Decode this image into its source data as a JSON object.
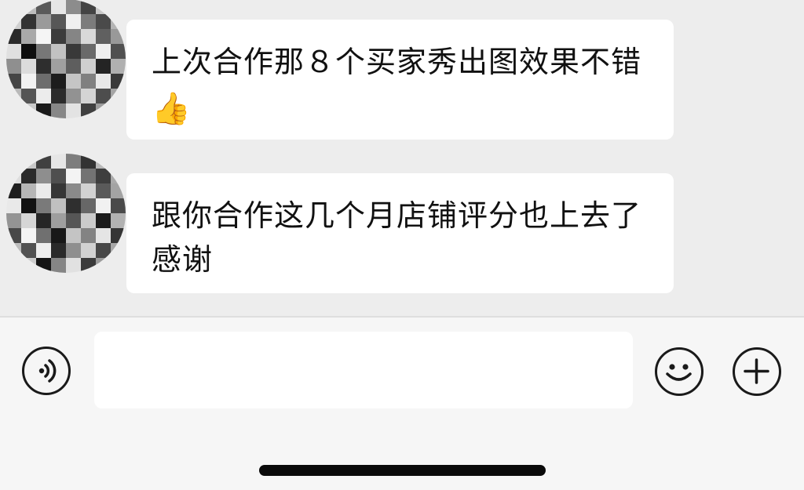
{
  "messages": [
    {
      "text": "上次合作那８个买家秀出图效果不错",
      "emoji": "👍"
    },
    {
      "text": "跟你合作这几个月店铺评分也上去了 感谢",
      "emoji": ""
    }
  ],
  "input_bar": {
    "voice_icon": "voice-icon",
    "emoji_icon": "emoji-icon",
    "plus_icon": "plus-icon",
    "input_value": "",
    "input_placeholder": ""
  },
  "colors": {
    "background": "#ededed",
    "bubble": "#ffffff",
    "input_bar": "#f6f6f6"
  }
}
